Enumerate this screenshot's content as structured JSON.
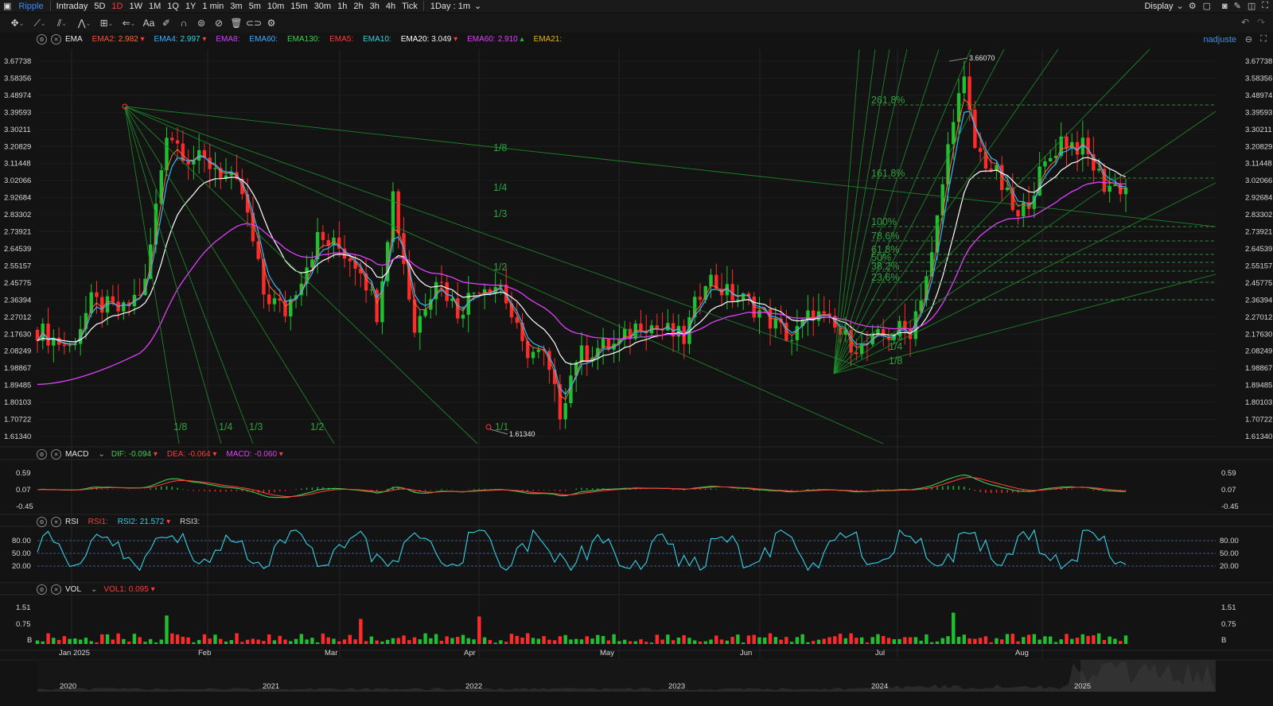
{
  "topbar": {
    "symbol": "Ripple",
    "periods": [
      "Intraday",
      "5D",
      "1D",
      "1W",
      "1M",
      "1Q",
      "1Y",
      "1 min",
      "3m",
      "5m",
      "10m",
      "15m",
      "30m",
      "1h",
      "2h",
      "3h",
      "4h",
      "Tick"
    ],
    "active_period": "1D",
    "interval_select": "1Day : 1m",
    "display_label": "Display"
  },
  "toolbar_icons": [
    "move-icon",
    "line-tool-icon",
    "channel-tool-icon",
    "pattern-tool-icon",
    "measure-tool-icon",
    "arrow-tool-icon",
    "text-tool-icon",
    "pen-icon",
    "magnet-icon",
    "lock-icon",
    "hide-icon",
    "trash-icon",
    "link-icon",
    "settings-icon"
  ],
  "ema_row": {
    "name": "EMA",
    "items": [
      {
        "label": "EMA2:",
        "value": "2.982",
        "color": "#ff4d2d",
        "arrow": "down"
      },
      {
        "label": "EMA4:",
        "value": "2.997",
        "color": "#3ab0ff",
        "arrow": "down"
      },
      {
        "label": "EMA8:",
        "value": "",
        "color": "#d040ff",
        "arrow": ""
      },
      {
        "label": "EMA60:",
        "value": "",
        "color": "#3ab0ff",
        "arrow": ""
      },
      {
        "label": "EMA130:",
        "value": "",
        "color": "#3ccf4e",
        "arrow": ""
      },
      {
        "label": "EMA5:",
        "value": "",
        "color": "#ff3b3b",
        "arrow": ""
      },
      {
        "label": "EMA10:",
        "value": "",
        "color": "#35d0e6",
        "arrow": ""
      },
      {
        "label": "EMA20:",
        "value": "3.049",
        "color": "#ffffff",
        "arrow": "down"
      },
      {
        "label": "EMA60:",
        "value": "2.910",
        "color": "#e040fb",
        "arrow": "up"
      },
      {
        "label": "EMA21:",
        "value": "",
        "color": "#e6b800",
        "arrow": ""
      }
    ],
    "adjust_label": "nadjuste"
  },
  "price_axis": [
    "3.67738",
    "3.58356",
    "3.48974",
    "3.39593",
    "3.30211",
    "3.20829",
    "3.11448",
    "3.02066",
    "2.92684",
    "2.83302",
    "2.73921",
    "2.64539",
    "2.55157",
    "2.45775",
    "2.36394",
    "2.27012",
    "2.17630",
    "2.08249",
    "1.98867",
    "1.89485",
    "1.80103",
    "1.70722",
    "1.61340"
  ],
  "price_marks": {
    "high": "3.66070",
    "low": "1.61340"
  },
  "fib_levels": [
    "261.8%",
    "161.8%",
    "100%",
    "78.6%",
    "61.8%",
    "50%",
    "38.2%",
    "23.6%"
  ],
  "fan_labels": [
    "1/8",
    "1/4",
    "1/3",
    "1/2",
    "1/1"
  ],
  "macd_row": {
    "name": "MACD",
    "items": [
      {
        "label": "DIF:",
        "value": "-0.094",
        "color": "#3ccf4e",
        "arrow": "down"
      },
      {
        "label": "DEA:",
        "value": "-0.064",
        "color": "#ff3b3b",
        "arrow": "down"
      },
      {
        "label": "MACD:",
        "value": "-0.060",
        "color": "#e040fb",
        "arrow": "down"
      }
    ],
    "axis": [
      "0.59",
      "0.07",
      "-0.45"
    ]
  },
  "rsi_row": {
    "name": "RSI",
    "items": [
      {
        "label": "RSI1:",
        "value": "",
        "color": "#ff3b3b",
        "arrow": ""
      },
      {
        "label": "RSI2:",
        "value": "21.572",
        "color": "#35d0e6",
        "arrow": "down"
      },
      {
        "label": "RSI3:",
        "value": "",
        "color": "#cfcfcf",
        "arrow": ""
      }
    ],
    "axis": [
      "80.00",
      "50.00",
      "20.00"
    ]
  },
  "vol_row": {
    "name": "VOL",
    "items": [
      {
        "label": "VOL1:",
        "value": "0.095",
        "color": "#ff3b3b",
        "arrow": "down"
      }
    ],
    "axis": [
      "1.51",
      "0.75",
      "B"
    ]
  },
  "time_axis": [
    "Jan 2025",
    "Feb",
    "Mar",
    "Apr",
    "May",
    "Jun",
    "Jul",
    "Aug"
  ],
  "overview_axis": [
    "2020",
    "2021",
    "2022",
    "2023",
    "2024",
    "2025"
  ],
  "colors": {
    "up": "#20c030",
    "down": "#ff2b2b",
    "bg": "#131313",
    "grid": "#262626",
    "fan": "#1f8f2a"
  }
}
